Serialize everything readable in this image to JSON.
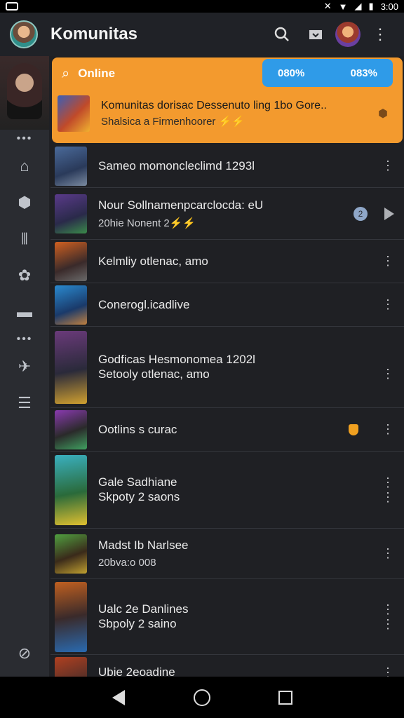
{
  "status": {
    "time": "3:00"
  },
  "app": {
    "title": "Komunitas"
  },
  "banner": {
    "search_label": "Online",
    "pill_left": "080%",
    "pill_right": "083%",
    "feature_line1": "Komunitas dorisac Dessenuto ling 1bo Gore..",
    "feature_line2": "Shalsica a Firmenhoorer ⚡⚡"
  },
  "list": [
    {
      "l1": "Sameo momoncleclimd 1293l",
      "l2": ""
    },
    {
      "l1": "Nour Sollnamenpcarclocda: eU",
      "l2": "20hie Nonent 2⚡⚡"
    },
    {
      "l1": "Kelmliy otlenac, amo",
      "l2": ""
    },
    {
      "l1": "Conerogl.icadlive",
      "l2": ""
    },
    {
      "l1": "Godficas Hesmonomea 1202l",
      "l2": "Setooly otlenac, amo"
    },
    {
      "l1": "Ootlins s curac",
      "l2": ""
    },
    {
      "l1": "Gale Sadhiane",
      "l2": "Skpoty 2 saons"
    },
    {
      "l1": "Madst Ib Narlsee",
      "l2": "20bva:o 008"
    },
    {
      "l1": "Ualc 2e Danlines",
      "l2": "Sbpoly 2 saino"
    },
    {
      "l1": "Ubie 2eoadine",
      "l2": ""
    }
  ],
  "colors": {
    "accent": "#f39a2e",
    "pill": "#2f9be8",
    "bg": "#1f2024"
  }
}
